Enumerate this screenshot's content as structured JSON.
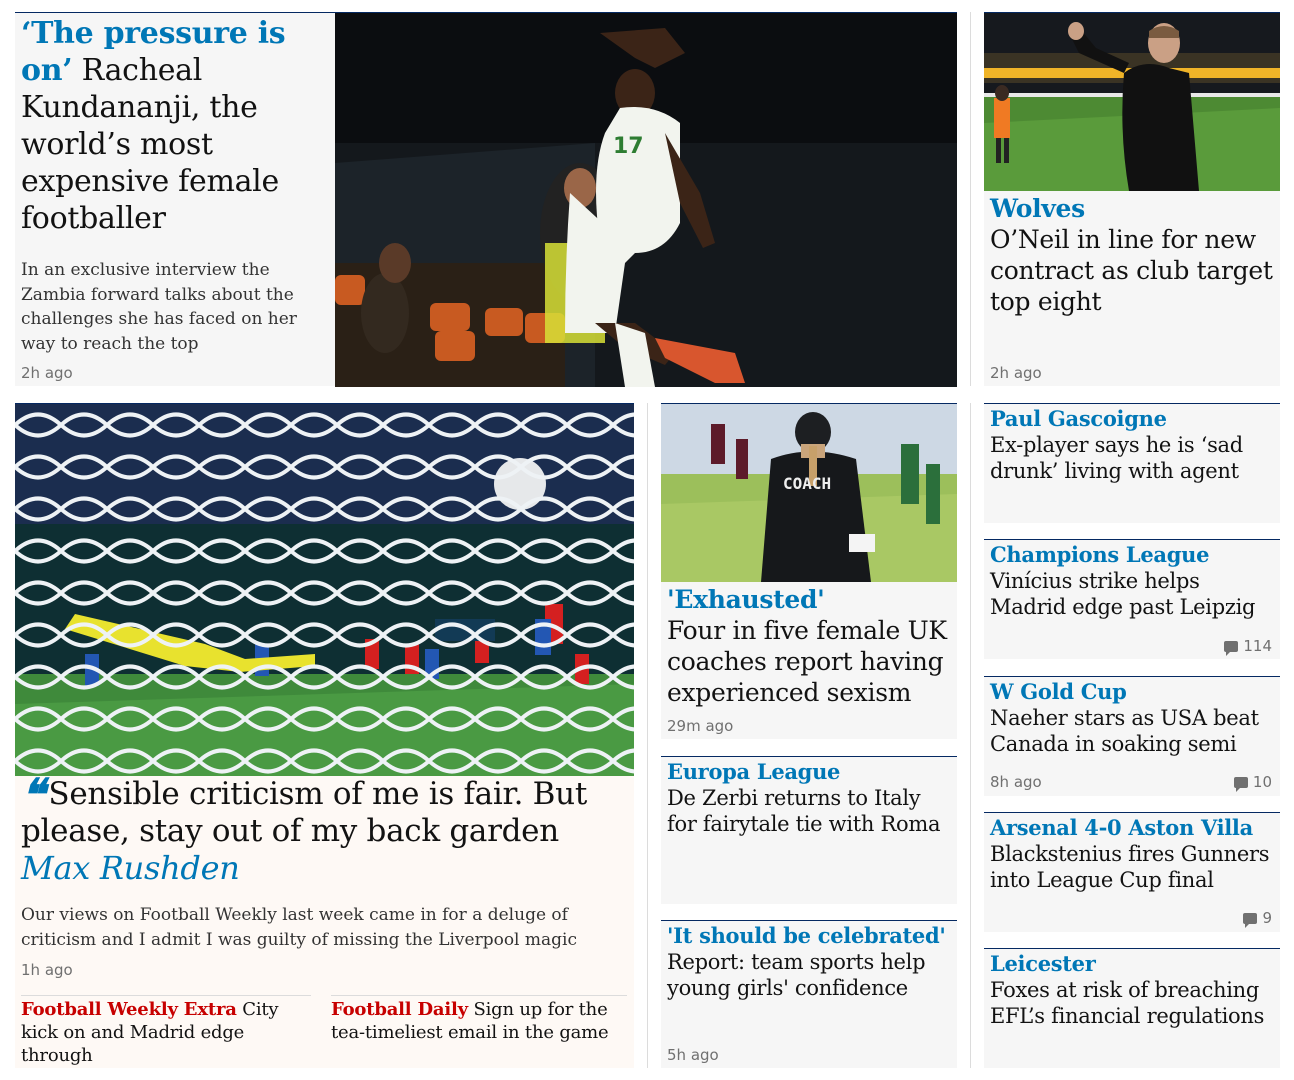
{
  "colors": {
    "accent": "#0077b6",
    "red": "#c70000",
    "opinion_bg": "#fef9f5"
  },
  "card1": {
    "kicker": "‘The pressure is on’",
    "headline": "Racheal Kundananji, the world’s most expensive female footballer",
    "trail": "In an exclusive interview the Zambia forward talks about the challenges she has faced on her way to reach the top",
    "age": "2h ago",
    "image_alt": "footballer-celebration-photo"
  },
  "card2": {
    "kicker": "Wolves",
    "headline": "O’Neil in line for new contract as club target top eight",
    "age": "2h ago",
    "image_alt": "manager-celebrating-photo"
  },
  "opinion": {
    "quote_icon": "quote-icon",
    "headline": "Sensible criticism of me is fair. But please, stay out of my back garden",
    "byline": "Max Rushden",
    "trail": "Our views on Football Weekly last week came in for a deluge of criticism and I admit I was guilty of missing the Liverpool magic",
    "age": "1h ago",
    "sublinks": [
      {
        "kicker": "Football Weekly Extra",
        "text": "City kick on and Madrid edge through"
      },
      {
        "kicker": "Football Daily",
        "text": "Sign up for the tea-timeliest email in the game"
      }
    ]
  },
  "card_exhausted": {
    "kicker": "'Exhausted'",
    "headline": "Four in five female UK coaches report having experienced sexism",
    "age": "29m ago",
    "image_text": "COACH"
  },
  "card_europa": {
    "kicker": "Europa League",
    "headline": "De Zerbi returns to Italy for fairytale tie with Roma"
  },
  "card_celebrated": {
    "kicker": "'It should be celebrated'",
    "headline": "Report: team sports help young girls' confidence",
    "age": "5h ago"
  },
  "right_list": [
    {
      "kicker": "Paul Gascoigne",
      "headline": "Ex-player says he is ‘sad drunk’ living with agent",
      "age": "",
      "comments": ""
    },
    {
      "kicker": "Champions League",
      "headline": "Vinícius strike helps Madrid edge past Leipzig",
      "age": "",
      "comments": "114"
    },
    {
      "kicker": "W Gold Cup",
      "headline": "Naeher stars as USA beat Canada in soaking semi",
      "age": "8h ago",
      "comments": "10"
    },
    {
      "kicker": "Arsenal 4-0 Aston Villa",
      "headline": "Blackstenius fires Gunners into League Cup final",
      "age": "",
      "comments": "9"
    },
    {
      "kicker": "Leicester",
      "headline": "Foxes at risk of breaching EFL’s financial regulations",
      "age": "",
      "comments": ""
    }
  ]
}
